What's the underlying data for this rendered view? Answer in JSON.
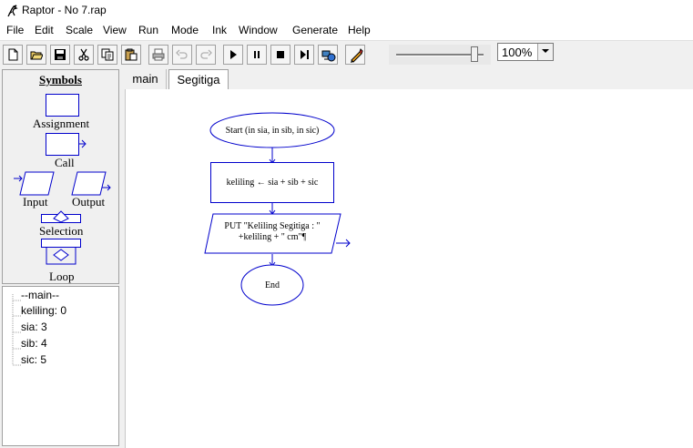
{
  "window": {
    "title": "Raptor - No 7.rap"
  },
  "menu": [
    "File",
    "Edit",
    "Scale",
    "View",
    "Run",
    "Mode",
    "Ink",
    "Window",
    "Generate",
    "Help"
  ],
  "toolbar": {
    "zoom_value": "100%",
    "slider_level": 0.9
  },
  "symbols": {
    "title": "Symbols",
    "assignment": "Assignment",
    "call": "Call",
    "input": "Input",
    "output": "Output",
    "selection": "Selection",
    "loop": "Loop"
  },
  "variables": {
    "header": "--main--",
    "items": [
      "keliling: 0",
      "sia: 3",
      "sib: 4",
      "sic: 5"
    ]
  },
  "tabs": [
    "main",
    "Segitiga"
  ],
  "flowchart": {
    "start": "Start (in sia, in sib, in sic)",
    "assign": "keliling ← sia + sib + sic",
    "output_line1": "PUT \"Keliling Segitiga : \"",
    "output_line2": "+keliling + \" cm\"¶",
    "end": "End"
  },
  "colors": {
    "shape_stroke": "#0000cc",
    "canvas_bg": "#ffffff"
  }
}
